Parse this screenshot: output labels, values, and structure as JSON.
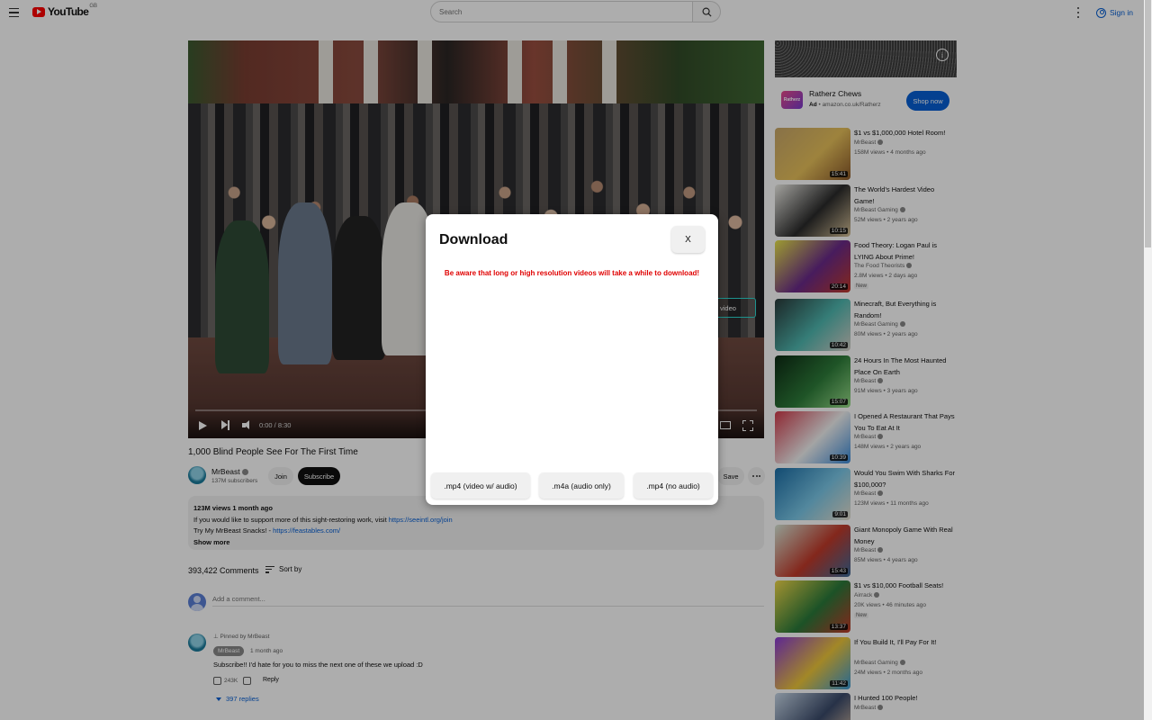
{
  "header": {
    "logo_text": "YouTube",
    "logo_country": "GB",
    "search_placeholder": "Search",
    "signin_label": "Sign in"
  },
  "player": {
    "time": "0:00 / 8:30",
    "info_card_label": "video"
  },
  "video": {
    "title": "1,000 Blind People See For The First Time",
    "channel": "MrBeast",
    "subscribers": "137M subscribers",
    "join_label": "Join",
    "subscribe_label": "Subscribe",
    "save_label": "Save",
    "description": {
      "stats": "123M views  1 month ago",
      "line1_text": "If you would like to support more of this sight-restoring work, visit ",
      "line1_link": "https://seeintl.org/join",
      "line2_text": "Try My MrBeast Snacks! - ",
      "line2_link": "https://feastables.com/",
      "show_more": "Show more"
    }
  },
  "comments": {
    "count": "393,422 Comments",
    "sort_label": "Sort by",
    "add_placeholder": "Add a comment...",
    "pinned_label": "Pinned by MrBeast",
    "author": "MrBeast",
    "time": "1 month ago",
    "text": "Subscribe!! I'd hate for you to miss the next one of these we upload :D",
    "likes": "243K",
    "reply_label": "Reply",
    "replies_label": "397 replies"
  },
  "ad": {
    "title": "Ratherz Chews",
    "ad_tag": "Ad",
    "domain": "amazon.co.uk/Ratherz",
    "cta": "Shop now",
    "logo_text": "Ratherz"
  },
  "recommendations": [
    {
      "title": "$1 vs $1,000,000 Hotel Room!",
      "channel": "MrBeast",
      "meta": "158M views • 4 months ago",
      "duration": "15:41",
      "colors": [
        "#c9a86a",
        "#e8c15b",
        "#8b5a2b"
      ]
    },
    {
      "title": "The World's Hardest Video Game!",
      "channel": "MrBeast Gaming",
      "meta": "52M views • 2 years ago",
      "duration": "10:15",
      "colors": [
        "#f0efe9",
        "#2b2b2b",
        "#d8c39a"
      ]
    },
    {
      "title": "Food Theory: Logan Paul is LYING About Prime!",
      "channel": "The Food Theorists",
      "meta": "2.8M views • 2 days ago",
      "duration": "20:14",
      "badge": "New",
      "colors": [
        "#e8e54a",
        "#6a2a8a",
        "#c23a2a"
      ]
    },
    {
      "title": "Minecraft, But Everything is Random!",
      "channel": "MrBeast Gaming",
      "meta": "80M views • 2 years ago",
      "duration": "10:42",
      "colors": [
        "#2a3a3a",
        "#4fb8b0",
        "#d8d0c8"
      ]
    },
    {
      "title": "24 Hours In The Most Haunted Place On Earth",
      "channel": "MrBeast",
      "meta": "91M views • 3 years ago",
      "duration": "15:07",
      "colors": [
        "#0d2a14",
        "#2e7d3a",
        "#9adf8a"
      ]
    },
    {
      "title": "I Opened A Restaurant That Pays You To Eat At It",
      "channel": "MrBeast",
      "meta": "148M views • 2 years ago",
      "duration": "10:39",
      "colors": [
        "#d23a4a",
        "#f2f2f2",
        "#3a8ad8"
      ]
    },
    {
      "title": "Would You Swim With Sharks For $100,000?",
      "channel": "MrBeast",
      "meta": "123M views • 11 months ago",
      "duration": "9:01",
      "colors": [
        "#1c6fa8",
        "#7ac8e8",
        "#e8e0d0"
      ]
    },
    {
      "title": "Giant Monopoly Game With Real Money",
      "channel": "MrBeast",
      "meta": "85M views • 4 years ago",
      "duration": "15:43",
      "colors": [
        "#d8e8d8",
        "#c23a2a",
        "#3a6a9a"
      ]
    },
    {
      "title": "$1 vs $10,000 Football Seats!",
      "channel": "Airrack",
      "meta": "20K views • 46 minutes ago",
      "duration": "13:37",
      "badge": "New",
      "colors": [
        "#f0d84a",
        "#2a7a3a",
        "#c23a2a"
      ]
    },
    {
      "title": "If You Build It, I'll Pay For It!",
      "channel": "MrBeast Gaming",
      "meta": "24M views • 2 months ago",
      "duration": "11:42",
      "colors": [
        "#8a3ad8",
        "#f0c83a",
        "#3a9ad8"
      ]
    },
    {
      "title": "I Hunted 100 People!",
      "channel": "MrBeast",
      "meta": "",
      "duration": "",
      "colors": [
        "#c8d8e8",
        "#3a4a6a",
        "#e8c8a8"
      ]
    }
  ],
  "modal": {
    "title": "Download",
    "close_label": "X",
    "warning": "Be aware that long or high resolution videos will take a while to download!",
    "buttons": [
      ".mp4 (video w/ audio)",
      ".m4a (audio only)",
      ".mp4 (no audio)"
    ]
  }
}
